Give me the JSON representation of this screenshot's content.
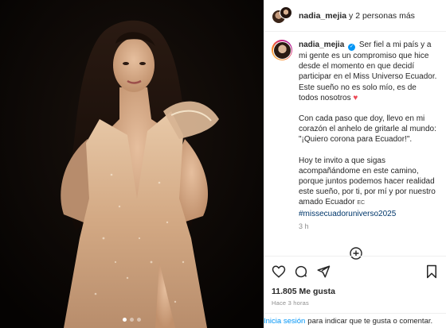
{
  "header": {
    "username": "nadia_mejia",
    "others": " y 2 personas más"
  },
  "post": {
    "username": "nadia_mejia",
    "paragraphs": [
      "Ser fiel a mi país y a mi gente es un compromiso que hice desde el momento en que decidí participar en el Miss Universo Ecuador. Este sueño no es solo mío, es de todos nosotros",
      "Con cada paso que doy, llevo en mi corazón el anhelo de gritarle al mundo: \"¡Quiero corona para Ecuador!\".",
      "Hoy te invito a que sigas acompañándome en este camino, porque juntos podemos hacer realidad este sueño, por ti, por mí y por nuestro amado Ecuador"
    ],
    "flag_code": "EC",
    "hashtag": "#missecuadoruniverso2025",
    "time": "3 h"
  },
  "stats": {
    "likes": "11.805 Me gusta",
    "date": "Hace 3 horas"
  },
  "login_bar": {
    "link": "Inicia sesión",
    "text": "para indicar que te gusta o comentar."
  },
  "icons": {
    "verified": "verified-badge-icon",
    "heart": "red-heart-emoji",
    "like": "heart-icon",
    "comment": "comment-icon",
    "share": "share-icon",
    "save": "bookmark-icon",
    "add": "add-circle-icon"
  },
  "colors": {
    "link": "#0095f6",
    "hashtag": "#00376b",
    "heart": "#ed4956",
    "muted": "#8e8e8e"
  },
  "carousel": {
    "count": 3,
    "active": 1
  }
}
